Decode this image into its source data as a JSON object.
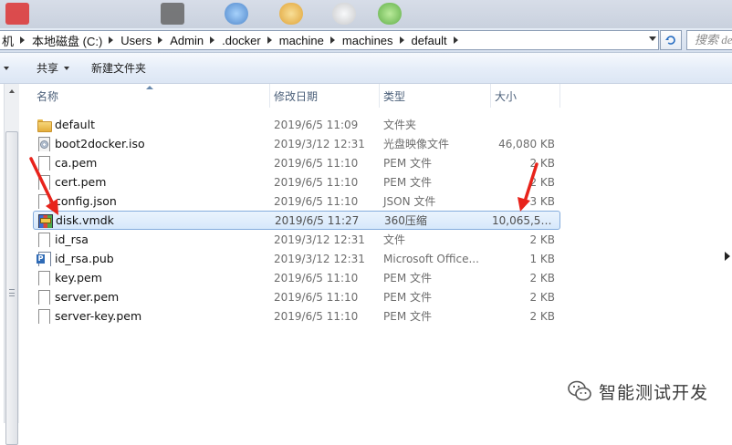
{
  "window": {
    "breadcrumb": [
      "机",
      "本地磁盘 (C:)",
      "Users",
      "Admin",
      ".docker",
      "machine",
      "machines",
      "default"
    ],
    "search_placeholder": "搜索 de"
  },
  "toolbar": {
    "share_label": "共享",
    "new_folder_label": "新建文件夹"
  },
  "columns": {
    "name": "名称",
    "date": "修改日期",
    "type": "类型",
    "size": "大小"
  },
  "files": [
    {
      "name": "default",
      "date": "2019/6/5 11:09",
      "type": "文件夹",
      "size": "",
      "icon": "folder-icon"
    },
    {
      "name": "boot2docker.iso",
      "date": "2019/3/12 12:31",
      "type": "光盘映像文件",
      "size": "46,080 KB",
      "icon": "disc-image-icon"
    },
    {
      "name": "ca.pem",
      "date": "2019/6/5 11:10",
      "type": "PEM 文件",
      "size": "2 KB",
      "icon": "file-icon"
    },
    {
      "name": "cert.pem",
      "date": "2019/6/5 11:10",
      "type": "PEM 文件",
      "size": "2 KB",
      "icon": "file-icon"
    },
    {
      "name": "config.json",
      "date": "2019/6/5 11:10",
      "type": "JSON 文件",
      "size": "3 KB",
      "icon": "file-icon"
    },
    {
      "name": "disk.vmdk",
      "date": "2019/6/5 11:27",
      "type": "360压缩",
      "size": "10,065,53...",
      "icon": "archive-icon",
      "selected": true
    },
    {
      "name": "id_rsa",
      "date": "2019/3/12 12:31",
      "type": "文件",
      "size": "2 KB",
      "icon": "file-icon"
    },
    {
      "name": "id_rsa.pub",
      "date": "2019/3/12 12:31",
      "type": "Microsoft Office...",
      "size": "1 KB",
      "icon": "publisher-icon"
    },
    {
      "name": "key.pem",
      "date": "2019/6/5 11:10",
      "type": "PEM 文件",
      "size": "2 KB",
      "icon": "file-icon"
    },
    {
      "name": "server.pem",
      "date": "2019/6/5 11:10",
      "type": "PEM 文件",
      "size": "2 KB",
      "icon": "file-icon"
    },
    {
      "name": "server-key.pem",
      "date": "2019/6/5 11:10",
      "type": "PEM 文件",
      "size": "2 KB",
      "icon": "file-icon"
    }
  ],
  "watermark": {
    "text": "智能测试开发"
  },
  "colors": {
    "selection_border": "#84acdd",
    "annotation_arrow": "#e8231b"
  }
}
